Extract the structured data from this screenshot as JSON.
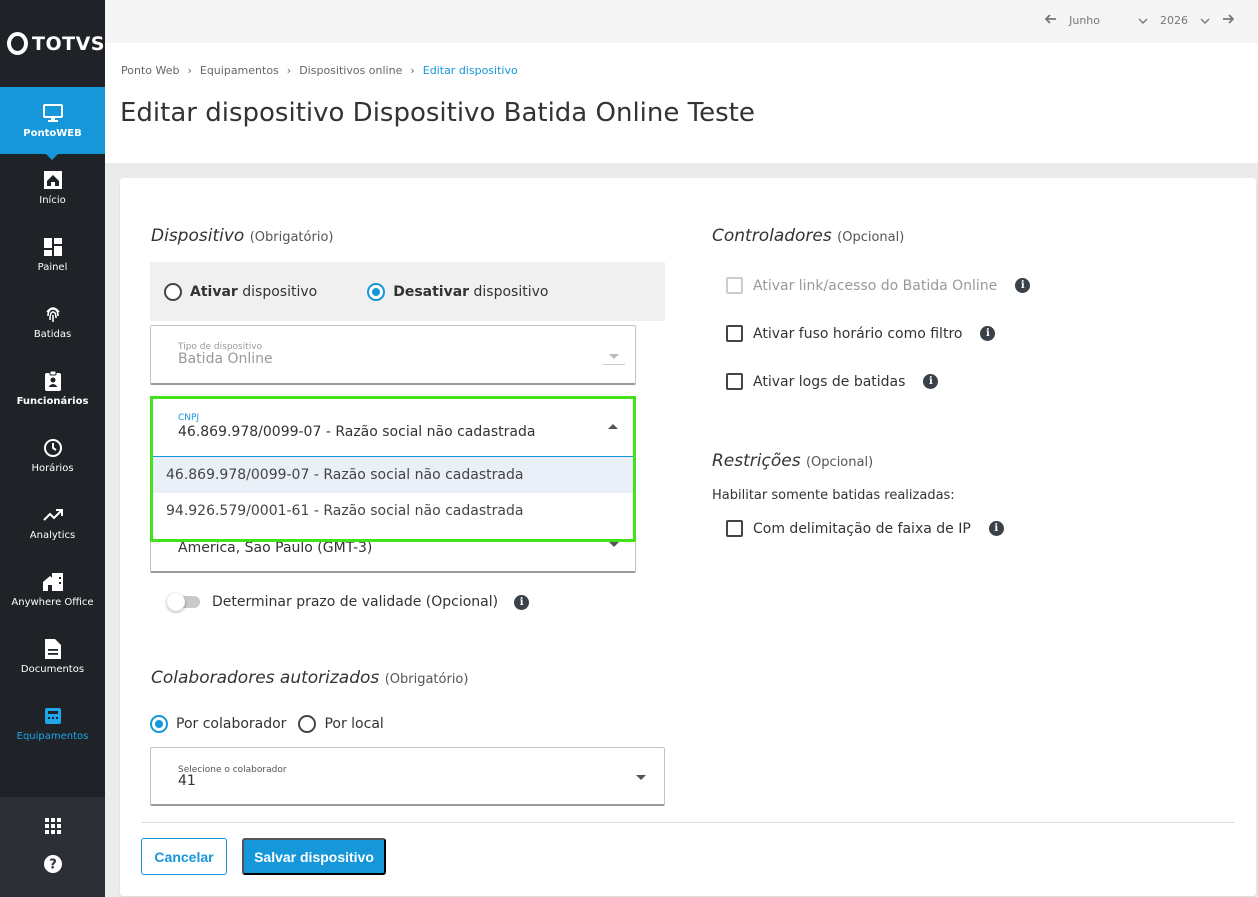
{
  "brand": {
    "name": "TOTVS"
  },
  "sidebar": {
    "items": [
      {
        "label": "PontoWEB",
        "icon": "monitor-icon"
      },
      {
        "label": "Início",
        "icon": "home-icon"
      },
      {
        "label": "Painel",
        "icon": "dashboard-icon"
      },
      {
        "label": "Batidas",
        "icon": "fingerprint-icon"
      },
      {
        "label": "Funcionários",
        "icon": "badge-icon"
      },
      {
        "label": "Horários",
        "icon": "clock-icon"
      },
      {
        "label": "Analytics",
        "icon": "trending-up-icon"
      },
      {
        "label": "Anywhere Office",
        "icon": "home-work-icon"
      },
      {
        "label": "Documentos",
        "icon": "document-icon"
      },
      {
        "label": "Equipamentos",
        "icon": "device-icon"
      }
    ],
    "bottom": [
      {
        "icon": "apps-grid-icon"
      },
      {
        "icon": "help-icon"
      }
    ]
  },
  "period": {
    "month": "Junho",
    "year": "2026"
  },
  "breadcrumb": [
    "Ponto Web",
    "Equipamentos",
    "Dispositivos online",
    "Editar dispositivo"
  ],
  "page_title": "Editar dispositivo Dispositivo Batida Online Teste",
  "device_section": {
    "title": "Dispositivo",
    "hint": "(Obrigatório)",
    "activate": {
      "strong": "Ativar",
      "rest": " dispositivo"
    },
    "deactivate": {
      "strong": "Desativar",
      "rest": " dispositivo"
    },
    "device_type": {
      "label": "Tipo de dispositivo",
      "value": "Batida Online"
    },
    "cnpj": {
      "label": "CNPJ",
      "value": "46.869.978/0099-07 - Razão social não cadastrada",
      "options": [
        "46.869.978/0099-07 - Razão social não cadastrada",
        "94.926.579/0001-61 - Razão social não cadastrada"
      ]
    },
    "timezone": {
      "value": "America, Sao Paulo (GMT-3)"
    },
    "validity": {
      "label": "Determinar prazo de validade (Opcional)"
    }
  },
  "collaborators": {
    "title": "Colaboradores autorizados",
    "hint": "(Obrigatório)",
    "by_collaborator": "Por colaborador",
    "by_location": "Por local",
    "select": {
      "label": "Selecione o colaborador",
      "value": "41"
    }
  },
  "controllers": {
    "title": "Controladores",
    "hint": "(Opcional)",
    "items": [
      "Ativar link/acesso do Batida Online",
      "Ativar fuso horário como filtro",
      "Ativar logs de batidas"
    ]
  },
  "restrictions": {
    "title": "Restrições",
    "hint": "(Opcional)",
    "subtitle": "Habilitar somente batidas realizadas:",
    "items": [
      "Com delimitação de faixa de IP"
    ]
  },
  "actions": {
    "cancel": "Cancelar",
    "save": "Salvar dispositivo"
  },
  "colors": {
    "accent": "#1697d9",
    "sidebar": "#1f2227",
    "highlight_border": "#44e21b"
  }
}
